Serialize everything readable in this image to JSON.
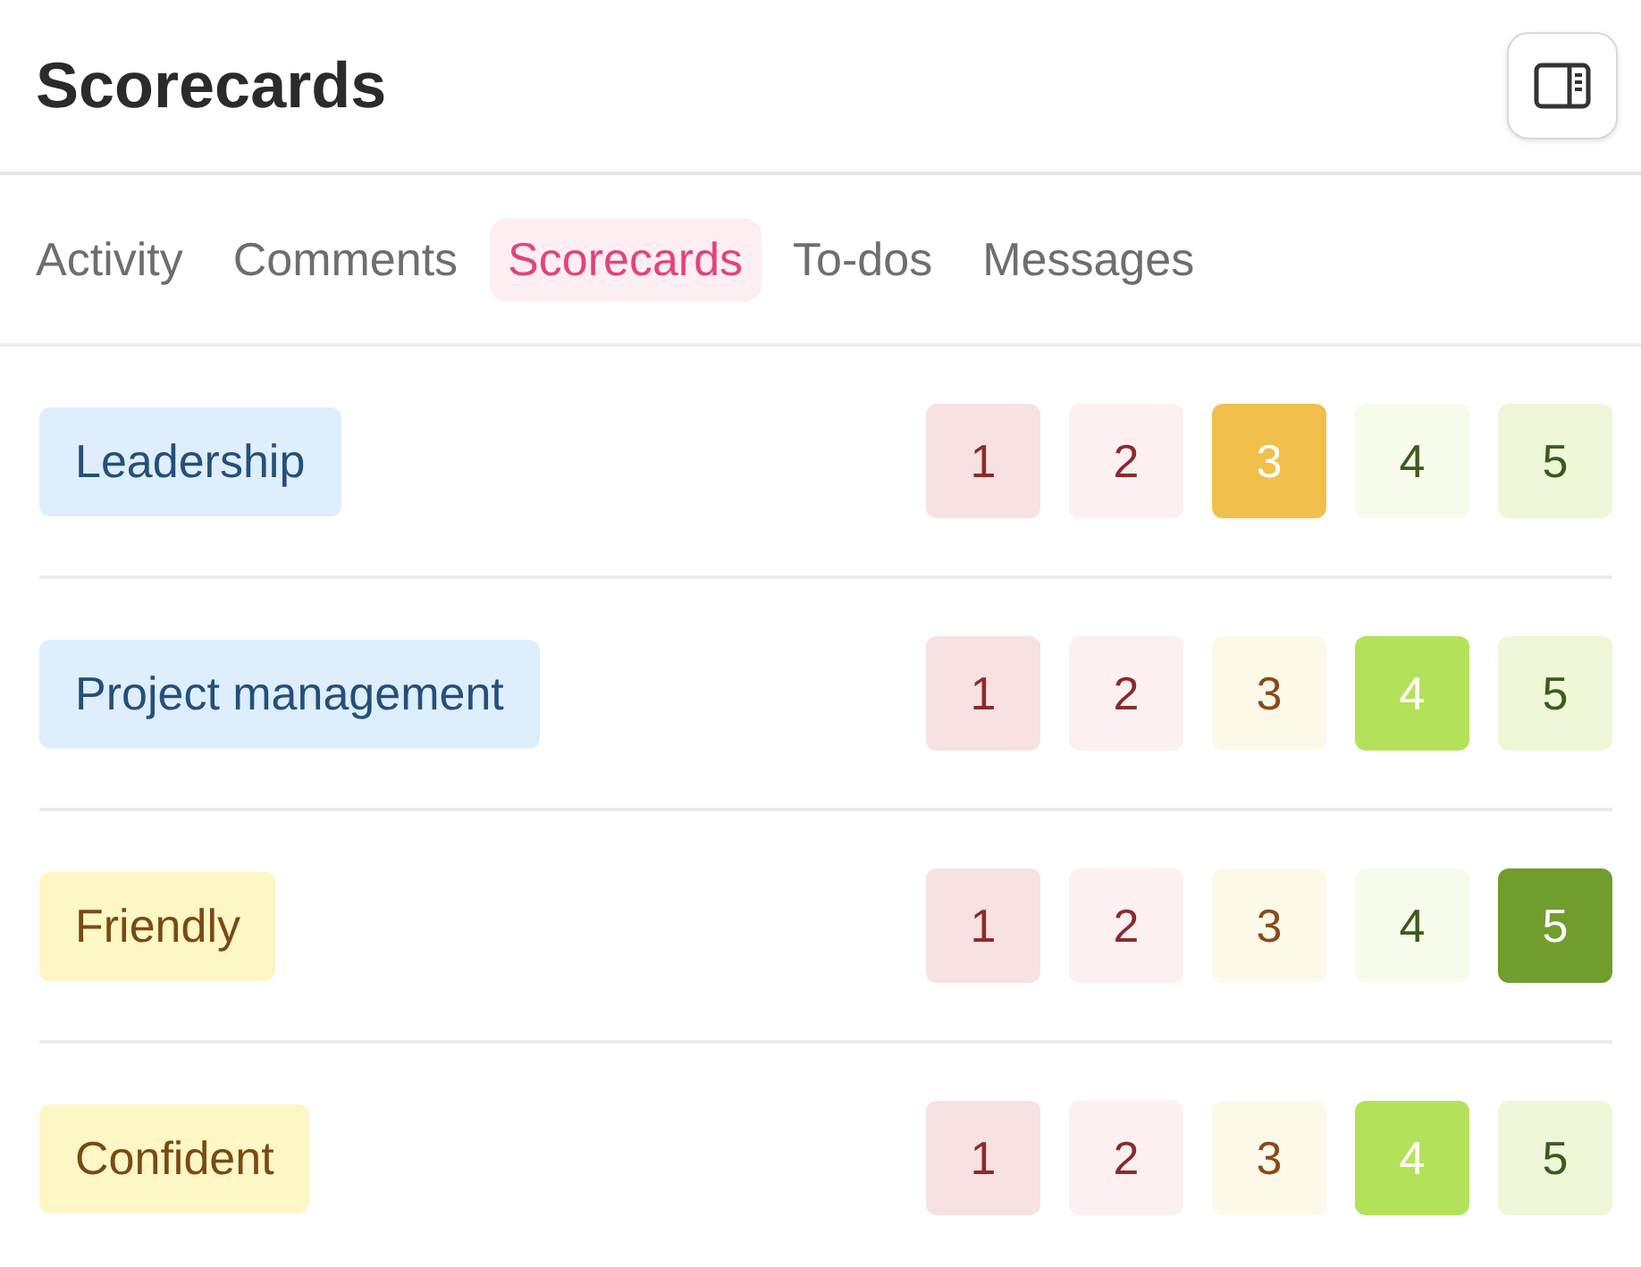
{
  "header": {
    "title": "Scorecards"
  },
  "tabs": [
    {
      "label": "Activity",
      "selected": false
    },
    {
      "label": "Comments",
      "selected": false
    },
    {
      "label": "Scorecards",
      "selected": true
    },
    {
      "label": "To-dos",
      "selected": false
    },
    {
      "label": "Messages",
      "selected": false
    }
  ],
  "scorecards": [
    {
      "tag": "Leadership",
      "color": "#dfeefc",
      "scores": [
        {
          "label": "1",
          "selected": false
        },
        {
          "label": "2",
          "selected": false
        },
        {
          "label": "3",
          "selected": true
        },
        {
          "label": "4",
          "selected": false
        },
        {
          "label": "5",
          "selected": false
        }
      ]
    },
    {
      "tag": "Project management",
      "color": "#dfeefc",
      "scores": [
        {
          "label": "1",
          "selected": false
        },
        {
          "label": "2",
          "selected": false
        },
        {
          "label": "3",
          "selected": false
        },
        {
          "label": "4",
          "selected": true
        },
        {
          "label": "5",
          "selected": false
        }
      ]
    },
    {
      "tag": "Friendly",
      "color": "#fdf7c6",
      "scores": [
        {
          "label": "1",
          "selected": false
        },
        {
          "label": "2",
          "selected": false
        },
        {
          "label": "3",
          "selected": false
        },
        {
          "label": "4",
          "selected": false
        },
        {
          "label": "5",
          "selected": true
        }
      ]
    },
    {
      "tag": "Confident",
      "color": "#fdf7c6",
      "scores": [
        {
          "label": "1",
          "selected": false
        },
        {
          "label": "2",
          "selected": false
        },
        {
          "label": "3",
          "selected": false
        },
        {
          "label": "4",
          "selected": true
        },
        {
          "label": "5",
          "selected": false
        }
      ]
    }
  ]
}
